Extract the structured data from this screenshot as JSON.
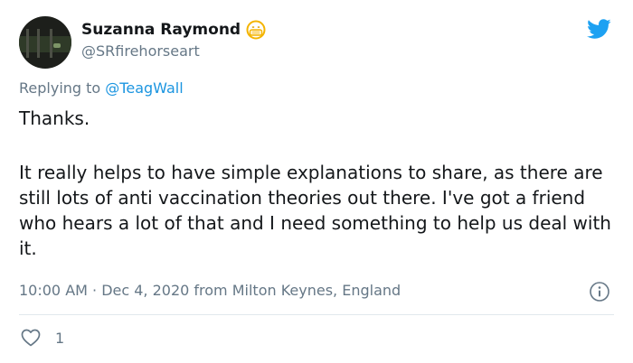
{
  "user": {
    "display_name": "Suzanna Raymond",
    "handle": "@SRfirehorseart",
    "name_emoji": "face-with-medical-mask-icon"
  },
  "reply": {
    "prefix": "Replying to ",
    "to_handle": "@TeagWall"
  },
  "tweet": {
    "line1": "Thanks.",
    "paragraph": "It really helps to have simple explanations to share, as there are still lots of anti vaccination theories out there. I've got a friend who hears a lot of that and I need something to help us deal with it."
  },
  "meta": {
    "text": "10:00 AM · Dec 4, 2020 from Milton Keynes, England"
  },
  "actions": {
    "like_count": "1"
  },
  "colors": {
    "brand": "#1da1f2",
    "link": "#1b95e0",
    "muted": "#657786",
    "text": "#14171a"
  }
}
